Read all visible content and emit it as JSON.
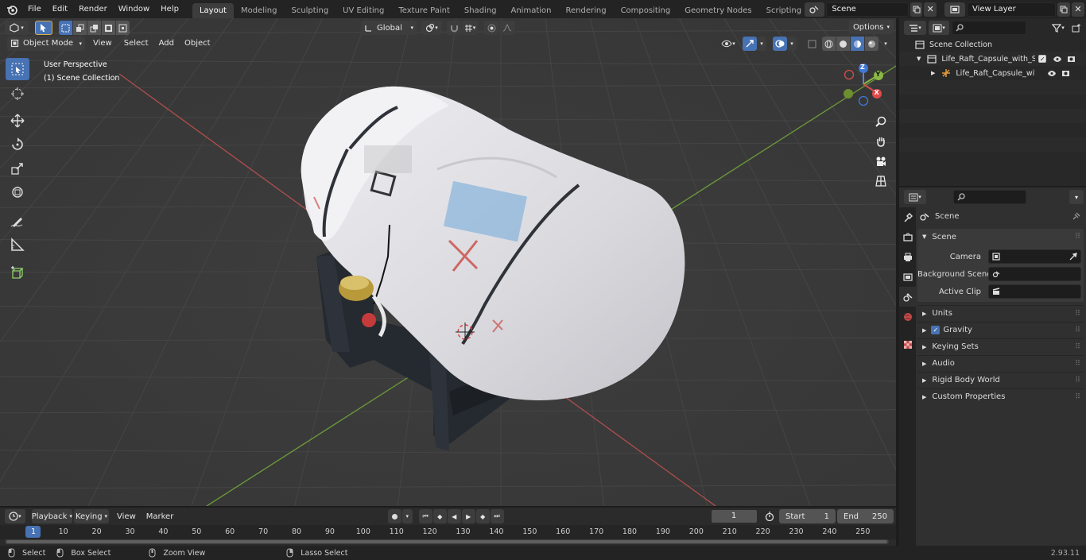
{
  "app": {
    "menus": [
      "File",
      "Edit",
      "Render",
      "Window",
      "Help"
    ],
    "workspaces": [
      "Layout",
      "Modeling",
      "Sculpting",
      "UV Editing",
      "Texture Paint",
      "Shading",
      "Animation",
      "Rendering",
      "Compositing",
      "Geometry Nodes",
      "Scripting"
    ],
    "active_workspace": "Layout",
    "add_tab": "+",
    "scene_name": "Scene",
    "view_layer": "View Layer"
  },
  "viewport": {
    "mode": "Object Mode",
    "menus": [
      "View",
      "Select",
      "Add",
      "Object"
    ],
    "transform_orientation": "Global",
    "options_label": "Options",
    "overlay_text_1": "User Perspective",
    "overlay_text_2": "(1) Scene Collection",
    "gizmo": {
      "z": "Z",
      "y": "Y",
      "x": "X"
    }
  },
  "outliner": {
    "search_placeholder": "",
    "root": "Scene Collection",
    "items": [
      {
        "label": "Life_Raft_Capsule_with_Stand"
      },
      {
        "label": "Life_Raft_Capsule_with_S"
      }
    ]
  },
  "properties": {
    "header_title": "Scene",
    "panel_title": "Scene",
    "rows": [
      {
        "label": "Camera"
      },
      {
        "label": "Background Scene"
      },
      {
        "label": "Active Clip"
      }
    ],
    "subpanels": [
      "Units",
      "Gravity",
      "Keying Sets",
      "Audio",
      "Rigid Body World",
      "Custom Properties"
    ],
    "gravity_checked": true
  },
  "timeline": {
    "menus": [
      "Playback",
      "Keying",
      "View",
      "Marker"
    ],
    "current_frame": "1",
    "start_label": "Start",
    "start_value": "1",
    "end_label": "End",
    "end_value": "250",
    "ruler": [
      "1",
      "10",
      "20",
      "30",
      "40",
      "50",
      "60",
      "70",
      "80",
      "90",
      "100",
      "110",
      "120",
      "130",
      "140",
      "150",
      "160",
      "170",
      "180",
      "190",
      "200",
      "210",
      "220",
      "230",
      "240",
      "250"
    ]
  },
  "status": {
    "select": "Select",
    "box_select": "Box Select",
    "zoom_view": "Zoom View",
    "lasso_select": "Lasso Select",
    "version": "2.93.11"
  },
  "colors": {
    "accent": "#4772b3",
    "grid_x": "#b34d4d",
    "grid_y": "#6c9b3a"
  }
}
